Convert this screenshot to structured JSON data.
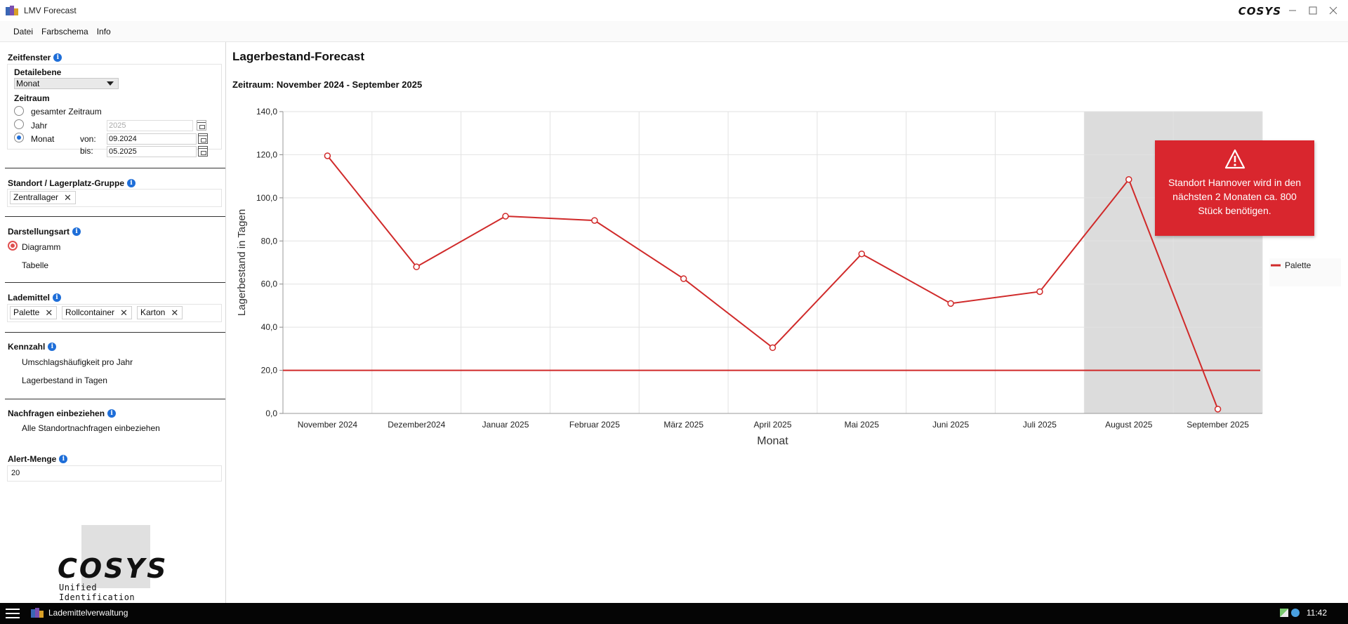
{
  "window": {
    "title": "LMV Forecast",
    "brand": "COSYS"
  },
  "menu": [
    "Datei",
    "Farbschema",
    "Info"
  ],
  "sidebar": {
    "zeitfenster": {
      "title": "Zeitfenster",
      "detail_label": "Detailebene",
      "detail_value": "Monat",
      "zeitraum_label": "Zeitraum",
      "options": [
        "gesamter Zeitraum",
        "Jahr",
        "Monat"
      ],
      "selected": "Monat",
      "jahr_value": "2025",
      "von_label": "von:",
      "von_value": "09.2024",
      "bis_label": "bis:",
      "bis_value": "05.2025"
    },
    "standort": {
      "title": "Standort / Lagerplatz-Gruppe",
      "chips": [
        "Zentrallager"
      ]
    },
    "darstellung": {
      "title": "Darstellungsart",
      "options": [
        "Diagramm",
        "Tabelle"
      ],
      "selected": "Diagramm"
    },
    "lademittel": {
      "title": "Lademittel",
      "chips": [
        "Palette",
        "Rollcontainer",
        "Karton"
      ]
    },
    "kennzahl": {
      "title": "Kennzahl",
      "options": [
        "Umschlagshäufigkeit pro Jahr",
        "Lagerbestand in Tagen"
      ]
    },
    "nachfragen": {
      "title": "Nachfragen einbeziehen",
      "option": "Alle Standortnachfragen einbeziehen"
    },
    "alert": {
      "title": "Alert-Menge",
      "value": "20"
    },
    "logo": {
      "text": "COSYS",
      "subtitle": "Unified Identification"
    }
  },
  "main": {
    "title": "Lagerbestand-Forecast",
    "subtitle": "Zeitraum: November 2024 - September 2025"
  },
  "chart_data": {
    "type": "line",
    "categories": [
      "November 2024",
      "Dezember2024",
      "Januar 2025",
      "Februar 2025",
      "März 2025",
      "April 2025",
      "Mai 2025",
      "Juni 2025",
      "Juli 2025",
      "August 2025",
      "September 2025"
    ],
    "series": [
      {
        "name": "Palette",
        "values": [
          119.5,
          68.0,
          91.5,
          89.5,
          62.5,
          30.5,
          74.0,
          51.0,
          56.5,
          108.5,
          2.0
        ],
        "color": "#d02a2a"
      }
    ],
    "threshold": 20.0,
    "forecast_categories": [
      "August 2025",
      "September 2025"
    ],
    "xlabel": "Monat",
    "ylabel": "Lagerbestand in Tagen",
    "ylim": [
      0,
      140
    ],
    "yticks": [
      "0,0",
      "20,0",
      "40,0",
      "60,0",
      "80,0",
      "100,0",
      "120,0",
      "140,0"
    ],
    "grid": true,
    "legend_position": "right"
  },
  "alert_popup": {
    "text": "Standort Hannover wird in den nächsten 2 Monaten ca. 800 Stück benötigen."
  },
  "taskbar": {
    "app": "Lademittelverwaltung",
    "clock": "11:42"
  },
  "colors": {
    "accent": "#1e6ed8",
    "alert": "#d9262e",
    "series": "#d02a2a",
    "forecast_band": "#dcdcdc"
  }
}
